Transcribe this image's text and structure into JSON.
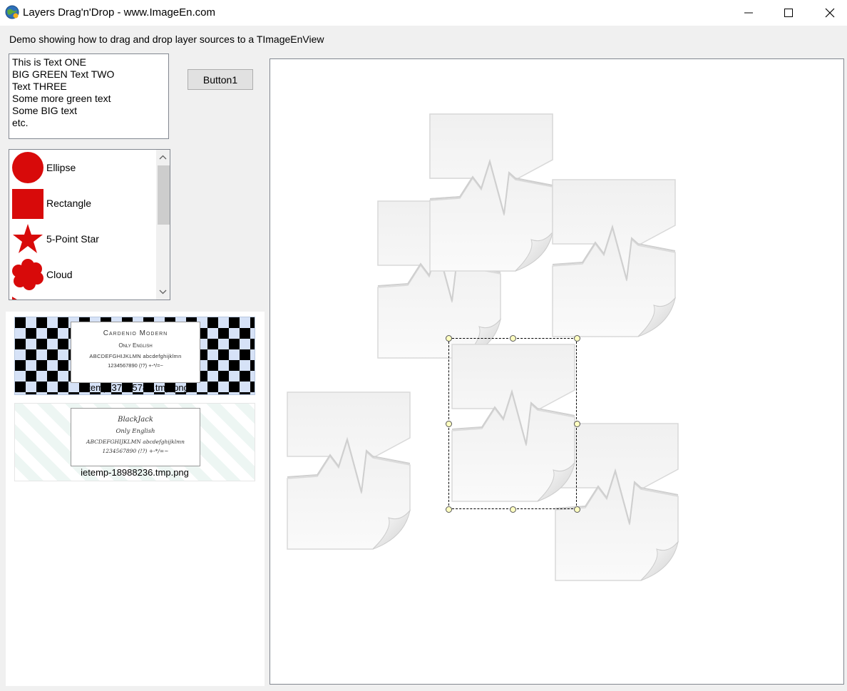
{
  "window": {
    "title": "Layers Drag'n'Drop - www.ImageEn.com",
    "controls": [
      "minimize",
      "maximize",
      "close"
    ]
  },
  "description": "Demo showing how to drag and drop layer sources to a TImageEnView",
  "memo": {
    "lines": [
      "This is Text ONE",
      "BIG GREEN Text TWO",
      "Text THREE",
      "Some more green text",
      "Some BIG text",
      "etc."
    ]
  },
  "button1": {
    "label": "Button1"
  },
  "shape_list": {
    "items": [
      {
        "label": "Ellipse",
        "icon": "ellipse-icon"
      },
      {
        "label": "Rectangle",
        "icon": "rectangle-icon"
      },
      {
        "label": "5-Point Star",
        "icon": "star-icon"
      },
      {
        "label": "Cloud",
        "icon": "cloud-icon"
      }
    ],
    "shape_color": "#d80a0a"
  },
  "thumbnails": [
    {
      "caption": "ietemp-37405781.tmp.png",
      "card": {
        "title": "Cardenio Modern",
        "subtitle": "Only English",
        "alphabet": "ABCDEFGHIJKLMN abcdefghijklmn",
        "digits": "1234567890 (!?) +-*/=~"
      }
    },
    {
      "caption": "ietemp-18988236.tmp.png",
      "card": {
        "title": "BlackJack",
        "subtitle": "Only English",
        "alphabet": "ABCDEFGHIJKLMN abcdefghijklmn",
        "digits": "1234567890 (!?) +-*/=~"
      }
    }
  ],
  "image_view": {
    "layer_icon": "document-heartbeat-icon",
    "selected_layer": 6
  }
}
